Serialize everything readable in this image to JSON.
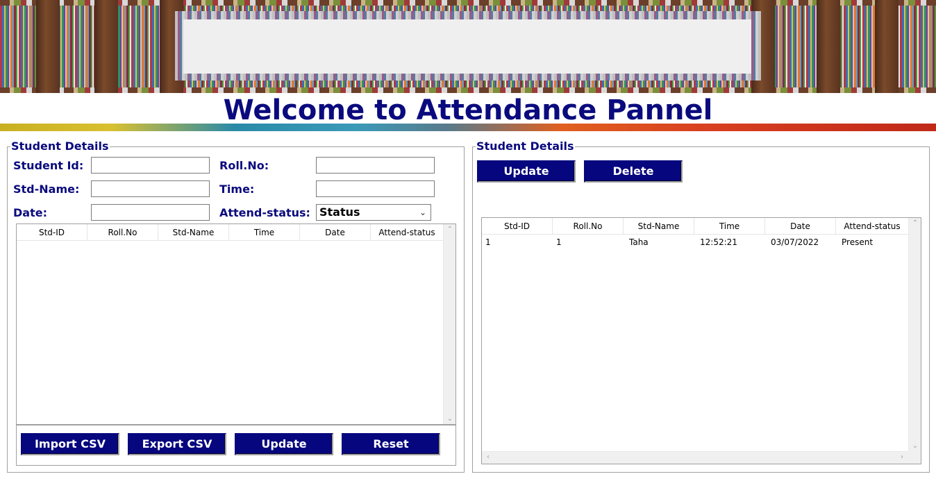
{
  "title": "Welcome to Attendance Pannel",
  "colors": {
    "brand_navy": "#0a0a7e",
    "button_bg": "#06067e",
    "button_text": "#ffffff"
  },
  "left_panel": {
    "legend": "Student Details",
    "fields": {
      "student_id_label": "Student Id:",
      "roll_no_label": "Roll.No:",
      "std_name_label": "Std-Name:",
      "time_label": "Time:",
      "date_label": "Date:",
      "attend_status_label": "Attend-status:",
      "student_id_value": "",
      "roll_no_value": "",
      "std_name_value": "",
      "time_value": "",
      "date_value": "",
      "attend_status_selected": "Status"
    },
    "table": {
      "columns": [
        "Std-ID",
        "Roll.No",
        "Std-Name",
        "Time",
        "Date",
        "Attend-status"
      ],
      "rows": []
    },
    "buttons": {
      "import_csv": "Import CSV",
      "export_csv": "Export CSV",
      "update": "Update",
      "reset": "Reset"
    }
  },
  "right_panel": {
    "legend": "Student Details",
    "buttons": {
      "update": "Update",
      "delete": "Delete"
    },
    "table": {
      "columns": [
        "Std-ID",
        "Roll.No",
        "Std-Name",
        "Time",
        "Date",
        "Attend-status"
      ],
      "rows": [
        [
          "1",
          "1",
          "Taha",
          "12:52:21",
          "03/07/2022",
          "Present"
        ]
      ]
    }
  },
  "icons": {
    "dropdown": "chevron-down-icon",
    "scroll_up": "scroll-up-arrow-icon",
    "scroll_down": "scroll-down-arrow-icon",
    "scroll_left": "scroll-left-arrow-icon",
    "scroll_right": "scroll-right-arrow-icon"
  }
}
